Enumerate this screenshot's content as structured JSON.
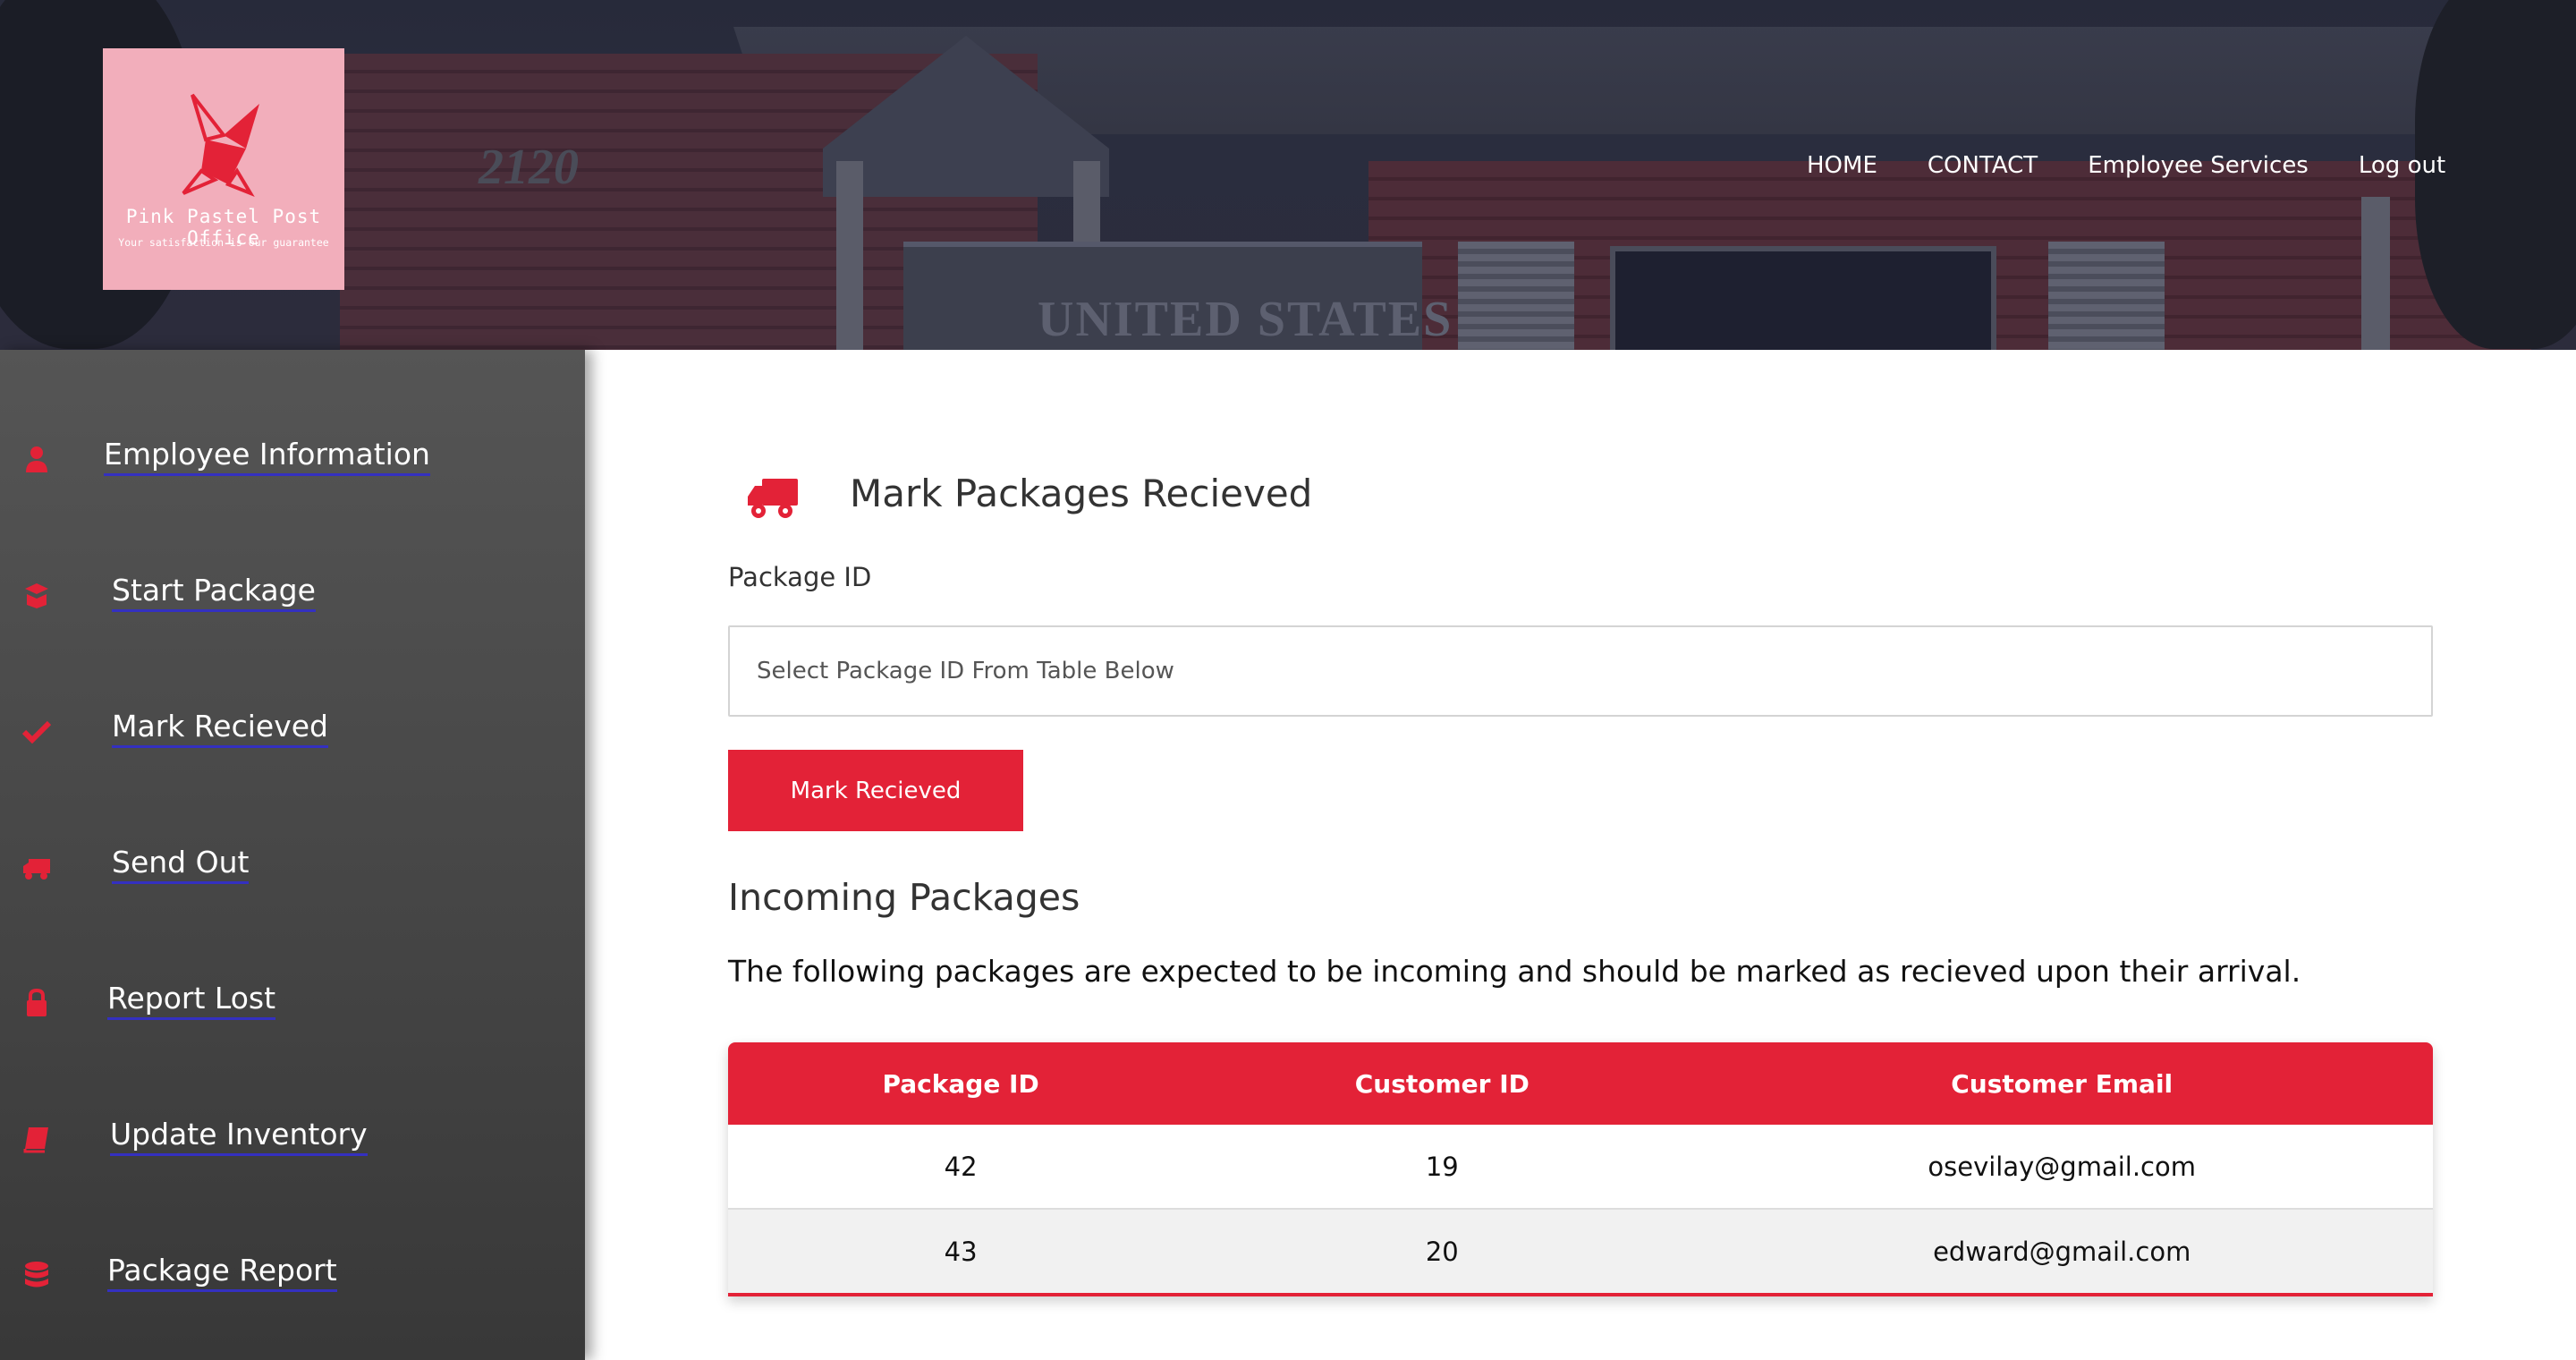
{
  "brand": {
    "name": "Pink Pastel Post Office",
    "tagline": "Your satisfaction is our guarantee",
    "colors": {
      "accent": "#e32237",
      "logo_bg": "#f2aebb"
    }
  },
  "hero": {
    "house_number": "2120",
    "sign_text": "UNITED STATES"
  },
  "topnav": [
    "HOME",
    "CONTACT",
    "Employee Services",
    "Log out"
  ],
  "sidebar": {
    "items": [
      {
        "label": "Employee Information",
        "icon": "user-icon"
      },
      {
        "label": "Start Package",
        "icon": "box-open-icon"
      },
      {
        "label": "Mark Recieved",
        "icon": "check-icon"
      },
      {
        "label": "Send Out",
        "icon": "truck-icon"
      },
      {
        "label": "Report Lost",
        "icon": "lock-icon"
      },
      {
        "label": "Update Inventory",
        "icon": "book-icon"
      },
      {
        "label": "Package Report",
        "icon": "database-icon"
      }
    ]
  },
  "main": {
    "title": "Mark Packages Recieved",
    "title_icon": "truck-icon",
    "field_label": "Package ID",
    "input": {
      "placeholder": "Select Package ID From Table Below",
      "value": ""
    },
    "button_label": "Mark Recieved",
    "incoming_title": "Incoming Packages",
    "incoming_desc": "The following packages are expected to be incoming and should be marked as recieved upon their arrival.",
    "table": {
      "headers": [
        "Package ID",
        "Customer ID",
        "Customer Email"
      ],
      "rows": [
        [
          "42",
          "19",
          "osevilay@gmail.com"
        ],
        [
          "43",
          "20",
          "edward@gmail.com"
        ]
      ]
    }
  }
}
